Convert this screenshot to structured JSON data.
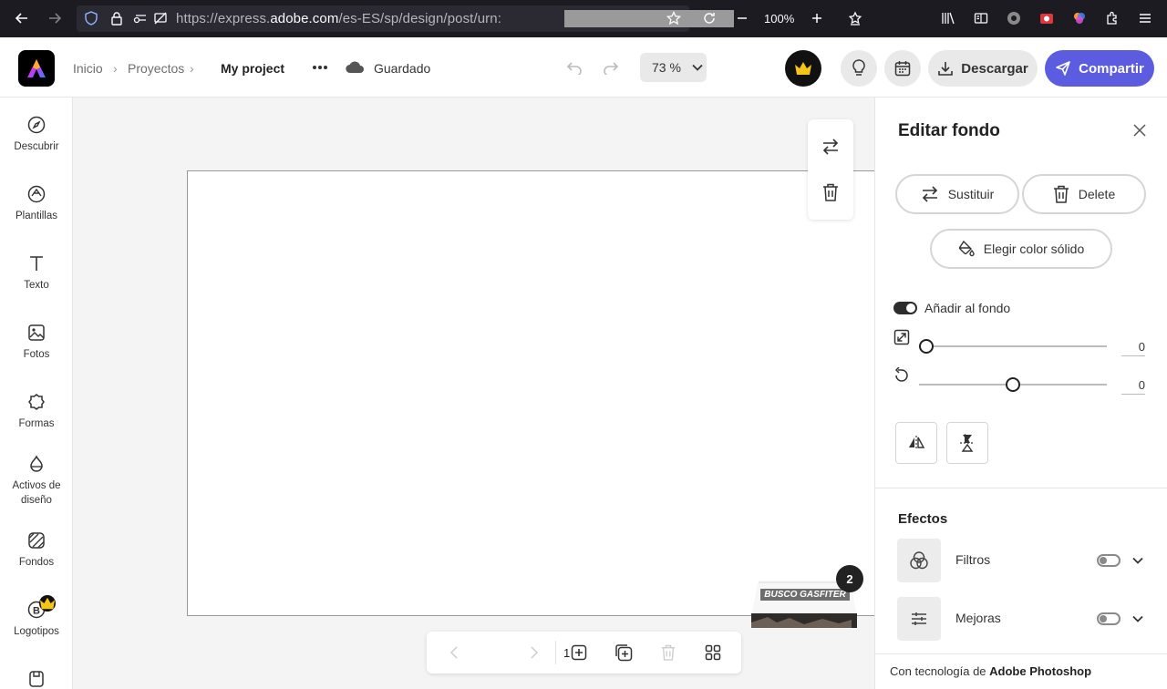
{
  "browser": {
    "url_prefix": "https://express.",
    "url_domain": "adobe.com",
    "url_path": "/es-ES/sp/design/post/urn:",
    "zoom": "100%"
  },
  "header": {
    "breadcrumbs": [
      "Inicio",
      "Proyectos"
    ],
    "project_name": "My project",
    "save_status": "Guardado",
    "zoom": "73 %",
    "download_label": "Descargar",
    "share_label": "Compartir"
  },
  "rail": {
    "items": [
      {
        "label": "Descubrir",
        "icon": "compass-icon"
      },
      {
        "label": "Plantillas",
        "icon": "templates-icon"
      },
      {
        "label": "Texto",
        "icon": "text-icon"
      },
      {
        "label": "Fotos",
        "icon": "photo-icon"
      },
      {
        "label": "Formas",
        "icon": "shapes-icon"
      },
      {
        "label": "Activos de diseño",
        "icon": "design-assets-icon"
      },
      {
        "label": "Fondos",
        "icon": "backgrounds-icon"
      },
      {
        "label": "Logotipos",
        "icon": "logo-icon"
      }
    ]
  },
  "canvas": {
    "page_number": "1",
    "thumbnail_text": "BUSCO GASFITER",
    "thumbnail_badge": "2"
  },
  "panel": {
    "title": "Editar fondo",
    "replace_label": "Sustituir",
    "delete_label": "Delete",
    "solid_color_label": "Elegir color sólido",
    "add_to_background_label": "Añadir al fondo",
    "scale_value": "0",
    "scale_fraction": 0.0,
    "rotate_value": "0",
    "rotate_fraction": 0.5,
    "effects_title": "Efectos",
    "filters_label": "Filtros",
    "enhancements_label": "Mejoras",
    "footer_prefix": "Con tecnología de ",
    "footer_brand": "Adobe Photoshop"
  },
  "colors": {
    "accent": "#5c5ce0",
    "crown": "#f5c518",
    "browser_bg": "#1c1b22"
  }
}
